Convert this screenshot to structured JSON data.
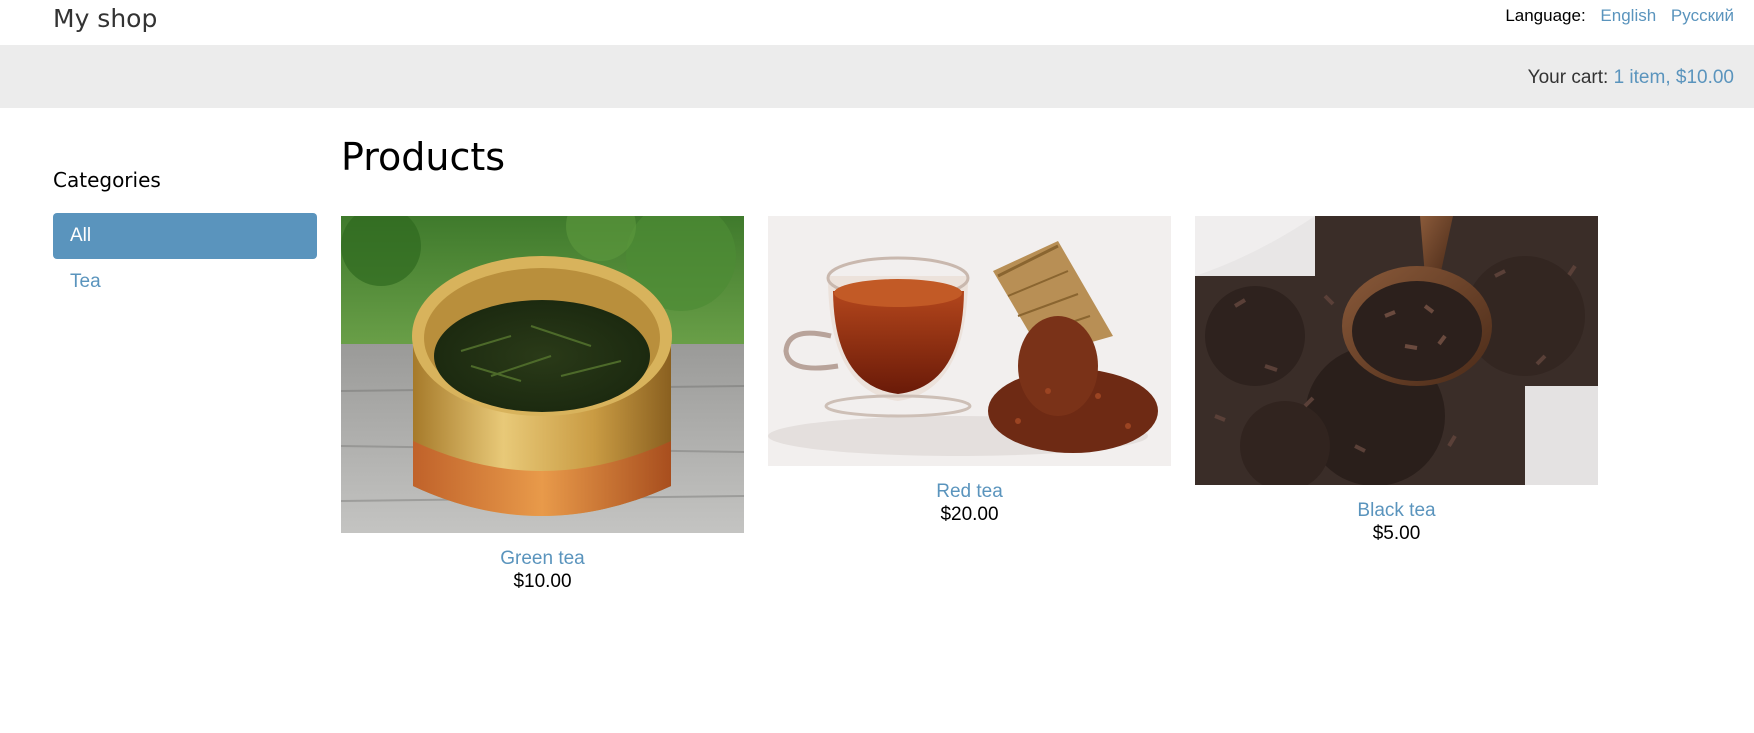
{
  "header": {
    "shop_title": "My shop",
    "language_label": "Language:",
    "languages": [
      {
        "label": "English"
      },
      {
        "label": "Русский"
      }
    ]
  },
  "cart": {
    "label": "Your cart:",
    "summary": "1 item, $10.00"
  },
  "sidebar": {
    "heading": "Categories",
    "items": [
      {
        "label": "All",
        "active": true
      },
      {
        "label": "Tea",
        "active": false
      }
    ]
  },
  "main": {
    "title": "Products",
    "products": [
      {
        "name": "Green tea",
        "price": "$10.00",
        "image": "green-tea-photo"
      },
      {
        "name": "Red tea",
        "price": "$20.00",
        "image": "red-tea-photo"
      },
      {
        "name": "Black tea",
        "price": "$5.00",
        "image": "black-tea-photo"
      }
    ]
  },
  "colors": {
    "link": "#5a94bd",
    "cart_bar": "#ececec",
    "active_category_bg": "#5a94bd"
  }
}
